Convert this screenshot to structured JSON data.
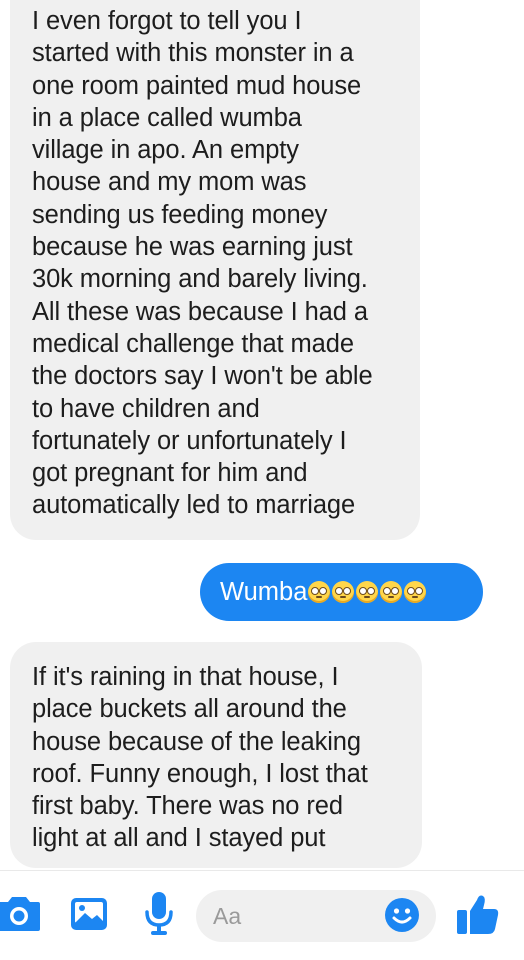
{
  "messages": [
    {
      "direction": "incoming",
      "text": "I even forgot to tell you I\nstarted with this monster in a\none room painted mud house\nin a place called wumba\nvillage in apo. An empty\nhouse and my mom was\nsending us feeding money\nbecause he was earning just\n30k morning and barely living.\nAll these was because I had a\nmedical challenge that made\nthe doctors say I won't be able\nto have children and\nfortunately or unfortunately I\ngot pregnant for him and\nautomatically led to marriage"
    },
    {
      "direction": "outgoing",
      "text": "Wumba",
      "emoji": "flushed-face",
      "emoji_count": 5
    },
    {
      "direction": "incoming",
      "text": "If it's raining in that house, I\nplace buckets all around the\nhouse because of the leaking\nroof. Funny enough, I lost that\nfirst baby. There was no red\nlight at all and I stayed put"
    }
  ],
  "composer": {
    "placeholder": "Aa",
    "icons": [
      "camera-icon",
      "gallery-icon",
      "microphone-icon",
      "emoji-icon",
      "thumbs-up-icon"
    ]
  },
  "colors": {
    "accent": "#1c86f2",
    "incoming_bubble": "#f0f0f0",
    "outgoing_bubble": "#1c86f2"
  }
}
